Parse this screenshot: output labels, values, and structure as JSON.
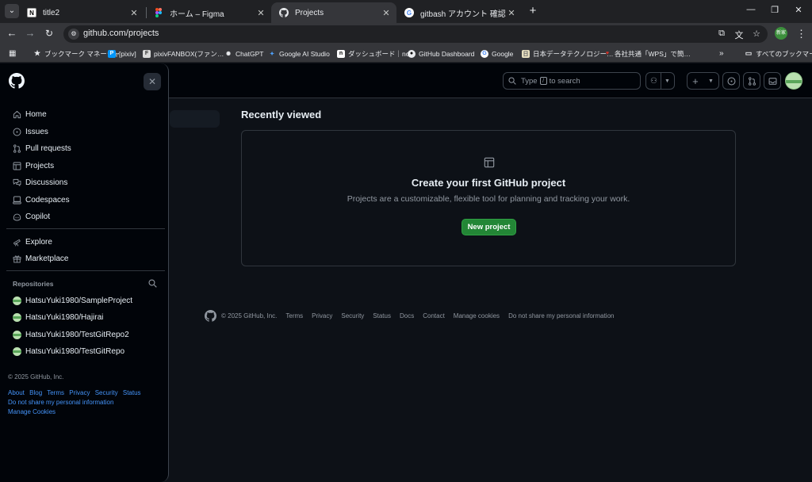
{
  "browser": {
    "tabs": [
      {
        "title": "title2",
        "favicon": "notion-icon",
        "active": false
      },
      {
        "title": "ホーム – Figma",
        "favicon": "figma-icon",
        "active": false
      },
      {
        "title": "Projects",
        "favicon": "github-icon",
        "active": true
      },
      {
        "title": "gitbash アカウント 確認 - Google",
        "favicon": "google-icon",
        "active": false
      }
    ],
    "url": "github.com/projects",
    "profile_label": "新家",
    "bookmarks": [
      {
        "label": "ブックマーク マネージャ",
        "icon": "star-icon"
      },
      {
        "label": "[pixiv]",
        "icon": "pixiv-icon"
      },
      {
        "label": "pixivFANBOX(ファン…",
        "icon": "fanbox-icon"
      },
      {
        "label": "ChatGPT",
        "icon": "chatgpt-icon"
      },
      {
        "label": "Google AI Studio",
        "icon": "ai-studio-icon"
      },
      {
        "label": "ダッシュボード｜note",
        "icon": "note-icon"
      },
      {
        "label": "GitHub Dashboard",
        "icon": "github-icon"
      },
      {
        "label": "Google",
        "icon": "google-icon"
      },
      {
        "label": "日本データテクノロジー…",
        "icon": "jdt-icon"
      },
      {
        "label": "各社共通「WPS」で簡…",
        "icon": "wps-icon"
      }
    ],
    "all_bookmarks": "すべてのブックマーク"
  },
  "header": {
    "search_prefix": "Type",
    "search_key": "/",
    "search_suffix": "to search"
  },
  "main": {
    "recently_viewed": "Recently viewed",
    "blankslate": {
      "title": "Create your first GitHub project",
      "description": "Projects are a customizable, flexible tool for planning and tracking your work.",
      "button": "New project"
    }
  },
  "footer": {
    "copyright": "© 2025 GitHub, Inc.",
    "links": [
      "Terms",
      "Privacy",
      "Security",
      "Status",
      "Docs",
      "Contact",
      "Manage cookies",
      "Do not share my personal information"
    ]
  },
  "drawer": {
    "nav": [
      {
        "label": "Home",
        "icon": "home-icon"
      },
      {
        "label": "Issues",
        "icon": "issue-opened-icon"
      },
      {
        "label": "Pull requests",
        "icon": "git-pull-request-icon"
      },
      {
        "label": "Projects",
        "icon": "table-icon"
      },
      {
        "label": "Discussions",
        "icon": "comment-discussion-icon"
      },
      {
        "label": "Codespaces",
        "icon": "codespaces-icon"
      },
      {
        "label": "Copilot",
        "icon": "copilot-icon"
      }
    ],
    "secondary": [
      {
        "label": "Explore",
        "icon": "telescope-icon"
      },
      {
        "label": "Marketplace",
        "icon": "gift-icon"
      }
    ],
    "repositories_heading": "Repositories",
    "repositories": [
      "HatsuYuki1980/SampleProject",
      "HatsuYuki1980/Hajirai",
      "HatsuYuki1980/TestGitRepo2",
      "HatsuYuki1980/TestGitRepo"
    ],
    "copyright": "© 2025 GitHub, Inc.",
    "links": [
      "About",
      "Blog",
      "Terms",
      "Privacy",
      "Security",
      "Status",
      "Do not share my personal information",
      "Manage Cookies"
    ]
  }
}
